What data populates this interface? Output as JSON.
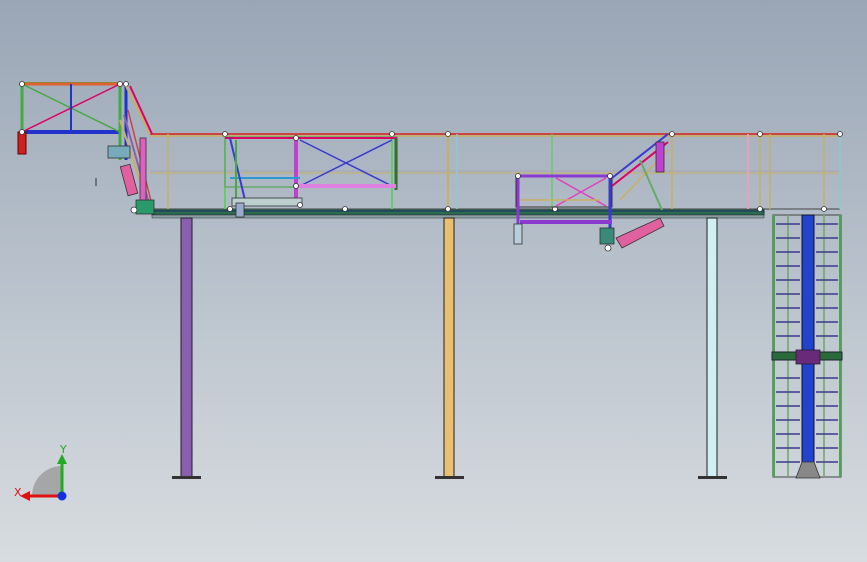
{
  "viewport": {
    "description_label": "3D model view",
    "background_top": "#9aa6b6",
    "background_bottom": "#d8dce0"
  },
  "triad": {
    "y_label": "Y",
    "x_label": "X",
    "y_color": "#22aa22",
    "x_color": "#dd1111",
    "z_color": "#1133dd"
  }
}
